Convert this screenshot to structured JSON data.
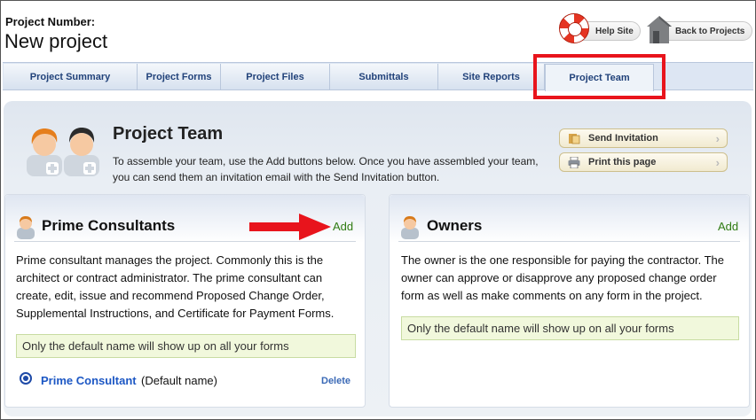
{
  "header": {
    "project_label": "Project Number:",
    "project_name": "New project",
    "help_label": "Help Site",
    "back_label": "Back to Projects"
  },
  "tabs": [
    {
      "label": "Project Summary",
      "active": false
    },
    {
      "label": "Project Forms",
      "active": false
    },
    {
      "label": "Project Files",
      "active": false
    },
    {
      "label": "Submittals",
      "active": false
    },
    {
      "label": "Site Reports",
      "active": false
    },
    {
      "label": "Project Team",
      "active": true
    }
  ],
  "team": {
    "title": "Project Team",
    "description": "To assemble your team, use the Add buttons below. Once you have assembled your team, you can send them an invitation email with the Send Invitation button.",
    "send_invitation": "Send Invitation",
    "print_page": "Print this page"
  },
  "prime": {
    "title": "Prime Consultants",
    "add_label": "Add",
    "description": "Prime consultant manages the project. Commonly this is the architect or contract administrator. The prime consultant can create, edit, issue and recommend Proposed Change Order, Supplemental Instructions, and Certificate for Payment Forms.",
    "note": "Only the default name will show up on all your forms",
    "member_name": "Prime Consultant",
    "member_default": "(Default name)",
    "delete_label": "Delete"
  },
  "owners": {
    "title": "Owners",
    "add_label": "Add",
    "description": "The owner is the one responsible for paying the contractor. The owner can approve or disapprove any proposed change order form as well as make comments on any form in the project.",
    "note": "Only the default name will show up on all your forms"
  },
  "colors": {
    "highlight": "#e8141c",
    "tab_text": "#21427a",
    "add_link": "#2f7b12",
    "member_link": "#1c57c4",
    "note_bg": "#f1f8dc"
  },
  "icons": [
    "lifering-icon",
    "house-icon",
    "team-icon",
    "invite-icon",
    "printer-icon",
    "person-icon",
    "arrow-annotation"
  ]
}
